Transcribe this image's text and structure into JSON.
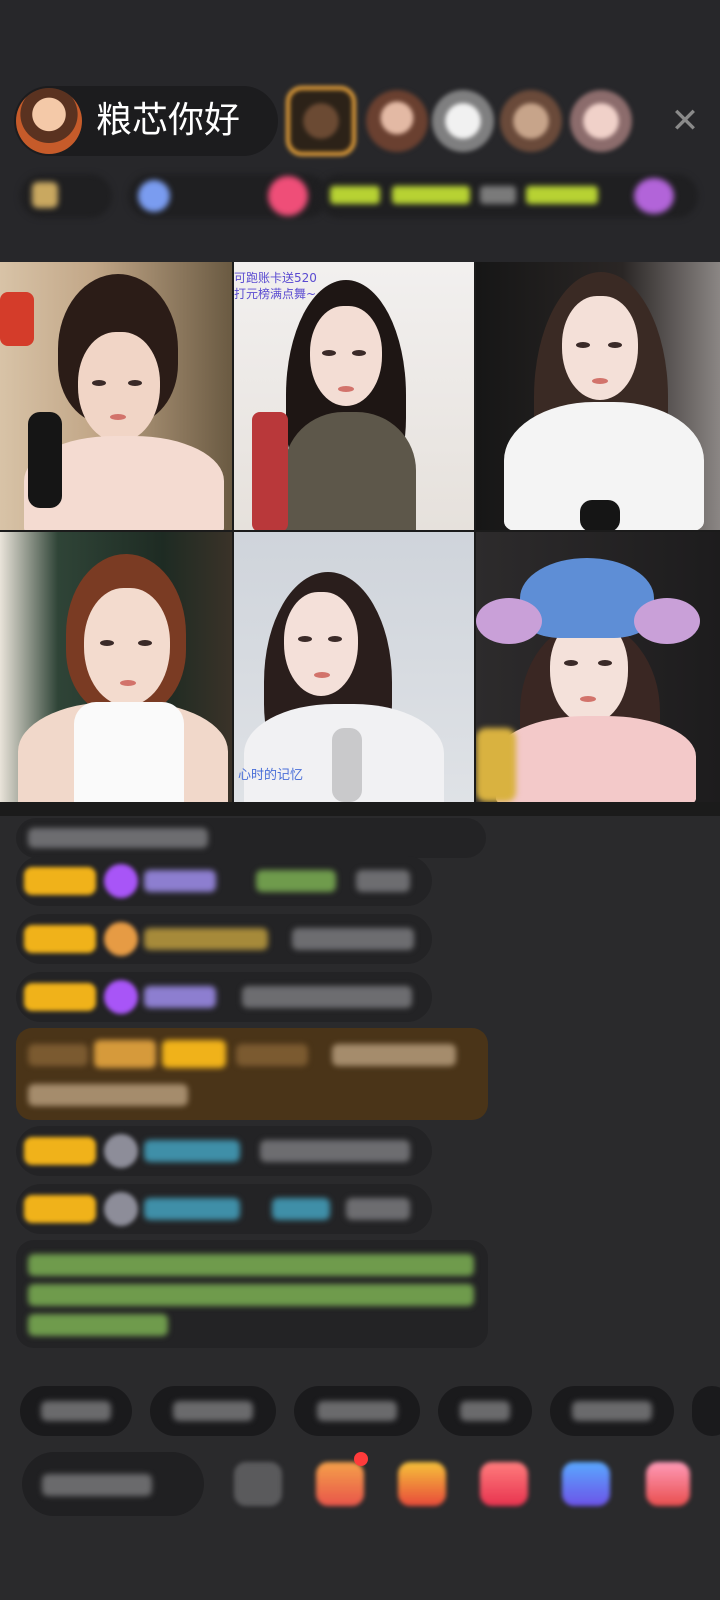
{
  "header": {
    "host_name": "粮芯你好",
    "close_icon": "close-icon"
  },
  "colors": {
    "background": "#2a2a2c",
    "accent_gold": "#f0b21a",
    "chat_bubble": "#232325",
    "highlight_bubble": "#4a3418",
    "green_text": "#7fb05a",
    "purple": "#a855f7"
  },
  "grid": {
    "tiles": [
      {
        "id": "streamer-1",
        "overlay": ""
      },
      {
        "id": "streamer-2",
        "overlay": "可跑账卡送520\n打元榜满点舞~"
      },
      {
        "id": "streamer-3",
        "overlay": ""
      },
      {
        "id": "streamer-4",
        "overlay": ""
      },
      {
        "id": "streamer-5",
        "overlay": ""
      },
      {
        "id": "streamer-6",
        "overlay": ""
      }
    ],
    "tile_5_caption": "心时的记忆"
  },
  "icons": {
    "close": "close-icon",
    "gem": "gem-icon",
    "gift": "gift-icon",
    "emoji": "emoji-icon"
  }
}
